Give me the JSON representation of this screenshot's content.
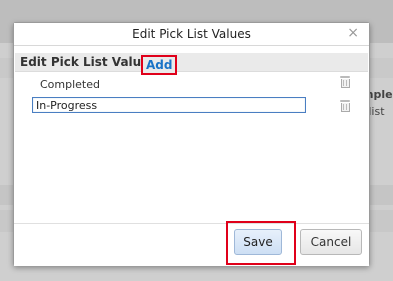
{
  "background": {
    "side_text_1": "mple",
    "side_text_2": "klist"
  },
  "dialog": {
    "title": "Edit Pick List Values",
    "close_label": "×",
    "section_title": "Edit Pick List Values",
    "add_label": "Add",
    "items": [
      {
        "label": "Completed"
      },
      {
        "value": "In-Progress"
      }
    ],
    "save_label": "Save",
    "cancel_label": "Cancel"
  },
  "colors": {
    "highlight": "#e0001a",
    "link": "#1a73c7",
    "input_border": "#4a7ec2"
  }
}
